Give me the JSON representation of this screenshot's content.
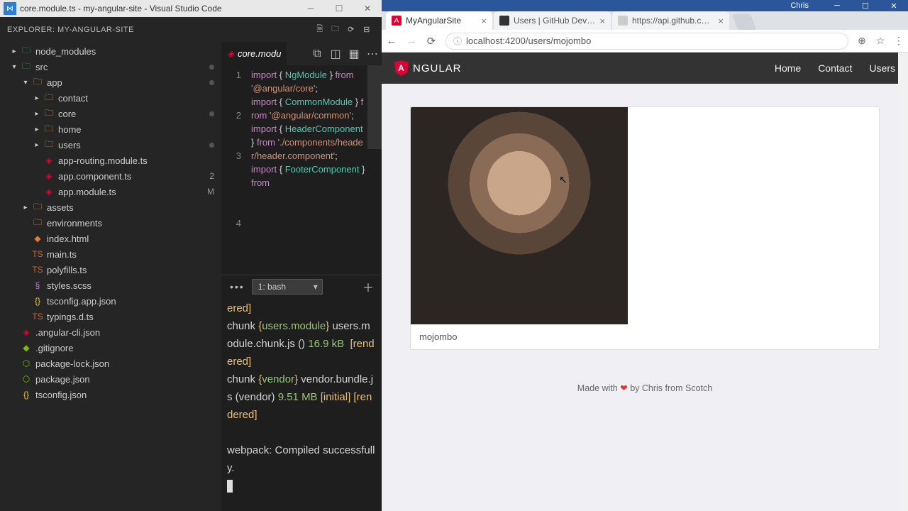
{
  "vscode": {
    "title": "core.module.ts - my-angular-site - Visual Studio Code",
    "explorer_label": "EXPLORER: MY-ANGULAR-SITE",
    "tree": {
      "node_modules": "node_modules",
      "src": "src",
      "app": "app",
      "contact": "contact",
      "core": "core",
      "home": "home",
      "users": "users",
      "app_routing": "app-routing.module.ts",
      "app_component": "app.component.ts",
      "app_component_badge": "2",
      "app_module": "app.module.ts",
      "app_module_badge": "M",
      "assets": "assets",
      "environments": "environments",
      "index_html": "index.html",
      "main_ts": "main.ts",
      "polyfills": "polyfills.ts",
      "styles": "styles.scss",
      "tsconfig_app": "tsconfig.app.json",
      "typings": "typings.d.ts",
      "angular_cli": ".angular-cli.json",
      "gitignore": ".gitignore",
      "package_lock": "package-lock.json",
      "package_json": "package.json",
      "tsconfig": "tsconfig.json"
    },
    "tab": "core.modu",
    "gutter": [
      "1",
      "",
      "",
      "2",
      "",
      "",
      "3",
      "",
      "",
      "",
      "",
      "4",
      "",
      ""
    ],
    "code_tokens": [
      [
        "kw",
        "import"
      ],
      [
        "br",
        " { "
      ],
      [
        "cls",
        "NgModule"
      ],
      [
        "br",
        " } "
      ],
      [
        "kw",
        "from"
      ],
      [
        "br",
        " "
      ],
      [
        "str",
        "'@angular/core'"
      ],
      [
        "br",
        ";\n"
      ],
      [
        "kw",
        "import"
      ],
      [
        "br",
        " { "
      ],
      [
        "cls",
        "CommonModule"
      ],
      [
        "br",
        " } "
      ],
      [
        "kw",
        "from"
      ],
      [
        "br",
        " "
      ],
      [
        "str",
        "'@angular/common'"
      ],
      [
        "br",
        ";\n"
      ],
      [
        "kw",
        "import"
      ],
      [
        "br",
        " { "
      ],
      [
        "cls",
        "HeaderComponent"
      ],
      [
        "br",
        " } "
      ],
      [
        "kw",
        "from"
      ],
      [
        "br",
        " "
      ],
      [
        "str",
        "'./components/header/header.component'"
      ],
      [
        "br",
        ";\n"
      ],
      [
        "kw",
        "import"
      ],
      [
        "br",
        " { "
      ],
      [
        "cls",
        "FooterComponent"
      ],
      [
        "br",
        " } "
      ],
      [
        "kw",
        "from"
      ],
      [
        "br",
        " "
      ]
    ],
    "terminal_select": "1: bash",
    "terminal_tokens": [
      [
        "ty",
        "ered]"
      ],
      [
        "tb",
        "\n"
      ],
      [
        "tb",
        "chunk "
      ],
      [
        "ty",
        "{"
      ],
      [
        "tg",
        "users.module"
      ],
      [
        "ty",
        "}"
      ],
      [
        "tb",
        " users.module.chunk.js () "
      ],
      [
        "tg",
        "16.9 kB"
      ],
      [
        "tb",
        "  "
      ],
      [
        "ty",
        "[rendered]"
      ],
      [
        "tb",
        "\n"
      ],
      [
        "tb",
        "chunk "
      ],
      [
        "ty",
        "{"
      ],
      [
        "tg",
        "vendor"
      ],
      [
        "ty",
        "}"
      ],
      [
        "tb",
        " vendor.bundle.js (vendor) "
      ],
      [
        "tg",
        "9.51 MB"
      ],
      [
        "tb",
        " "
      ],
      [
        "ty",
        "[initial] [rendered]"
      ],
      [
        "tb",
        "\n\n"
      ],
      [
        "tb",
        "webpack: Compiled successfully.\n"
      ]
    ]
  },
  "browser": {
    "win_user": "Chris",
    "tabs": [
      {
        "label": "MyAngularSite",
        "active": true,
        "iconColor": "#dd0031",
        "iconText": "A"
      },
      {
        "label": "Users | GitHub Develope",
        "active": false,
        "iconColor": "#333",
        "iconText": ""
      },
      {
        "label": "https://api.github.com/u",
        "active": false,
        "iconColor": "#ccc",
        "iconText": ""
      }
    ],
    "url": "localhost:4200/users/mojombo",
    "brand": "NGULAR",
    "nav": {
      "home": "Home",
      "contact": "Contact",
      "users": "Users"
    },
    "username": "mojombo",
    "footer_pre": "Made with ",
    "footer_heart": "❤",
    "footer_post": " by Chris from Scotch"
  }
}
